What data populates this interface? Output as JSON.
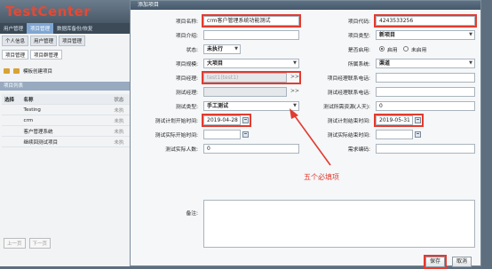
{
  "app": {
    "logo": "TestCenter",
    "nav": [
      "用户管理",
      "项目管理",
      "数据库备份/恢复"
    ],
    "nav_active_index": 1,
    "tabs": [
      "个人信息",
      "用户管理",
      "项目管理"
    ],
    "subtabs": [
      "项目管理",
      "项目群管理"
    ],
    "toolbar": [
      "模板创建项目"
    ],
    "section_title": "项目列表",
    "table_headers": [
      "选择",
      "名称",
      "状态"
    ],
    "rows": [
      {
        "name": "Testing",
        "status": "未执"
      },
      {
        "name": "crm",
        "status": "未执"
      },
      {
        "name": "客户管理系统",
        "status": "未执"
      },
      {
        "name": "继续回测试项目",
        "status": "未执"
      }
    ],
    "pager": [
      "上一页",
      "下一页"
    ]
  },
  "dialog": {
    "title": "添加项目",
    "project_name_label": "项目名称:",
    "project_name_value": "crm客户管理系统功能测试",
    "project_code_label": "项目代码:",
    "project_code_value": "4243533256",
    "intro_label": "项目介绍:",
    "intro_value": "",
    "type_label": "项目类型:",
    "type_value": "新项目",
    "status_label": "状态:",
    "status_value": "未执行",
    "enabled_label": "是否启用:",
    "enabled_on": "启用",
    "enabled_off": "未启用",
    "size_label": "项目规模:",
    "size_value": "大项目",
    "industry_label": "所属系统:",
    "industry_value": "渠道",
    "manager_label": "项目经理:",
    "manager_value": "test1(test1)",
    "manager_phone_label": "项目经理联系电话:",
    "test_manager_label": "测试经理:",
    "test_manager_phone_label": "测试经理联系电话:",
    "test_type_label": "测试类型:",
    "test_type_value": "手工测试",
    "resources_label": "测试所需资源(人天):",
    "resources_value": "0",
    "plan_start_label": "测试计划开始时间:",
    "plan_start_value": "2019-04-28",
    "plan_end_label": "测试计划结束时间:",
    "plan_end_value": "2019-05-31",
    "actual_start_label": "测试实际开始时间:",
    "actual_end_label": "测试实际结束时间:",
    "actual_people_label": "测试实际人数:",
    "actual_people_value": "0",
    "req_code_label": "需求编码:",
    "notes_label": "备注:",
    "save_label": "保存",
    "cancel_label": "取消"
  },
  "annotation": {
    "text": "五个必填项"
  },
  "colors": {
    "highlight": "#e23b2f",
    "title_bar": "#46586a"
  }
}
